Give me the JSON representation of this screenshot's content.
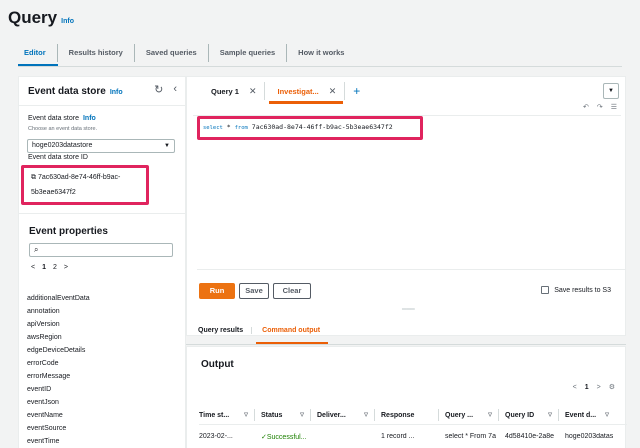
{
  "page": {
    "title": "Query",
    "info": "Info"
  },
  "tabs": [
    "Editor",
    "Results history",
    "Saved queries",
    "Sample queries",
    "How it works"
  ],
  "left_panel": {
    "title": "Event data store",
    "info": "Info",
    "refresh_icon": "refresh-icon",
    "collapse_icon": "chevron-left-icon",
    "store_label": "Event data store",
    "store_info": "Info",
    "store_hint": "Choose an event data store.",
    "store_value": "hoge0203datastore",
    "store_id_label": "Event data store ID",
    "store_id": "7ac630ad-8e74-46ff-b9ac-5b3eae6347f2",
    "event_props_title": "Event properties",
    "search_placeholder": "",
    "pager": {
      "prev": "<",
      "pages": [
        "1",
        "2"
      ],
      "next": ">"
    },
    "properties": [
      "additionalEventData",
      "annotation",
      "apiVersion",
      "awsRegion",
      "edgeDeviceDetails",
      "errorCode",
      "errorMessage",
      "eventID",
      "eventJson",
      "eventName",
      "eventSource",
      "eventTime"
    ]
  },
  "editor": {
    "tabs": [
      {
        "label": "Query 1",
        "active": false
      },
      {
        "label": "Investigat...",
        "active": true
      }
    ],
    "add_icon": "plus-icon",
    "query_kw1": "select",
    "query_star": " * ",
    "query_kw2": "from",
    "query_id": " 7ac630ad-8e74-46ff-b9ac-5b3eae6347f2",
    "run_label": "Run",
    "save_label": "Save",
    "clear_label": "Clear",
    "save_results_label": "Save results to S3"
  },
  "results": {
    "tabs": [
      "Query results",
      "Command output"
    ],
    "output_title": "Output",
    "pager": {
      "prev": "<",
      "current": "1",
      "next": ">"
    },
    "columns": [
      "Time st...",
      "Status",
      "Deliver...",
      "Response",
      "Query ...",
      "Query ID",
      "Event d..."
    ],
    "rows": [
      [
        "2023-02-...",
        "Successful...",
        "",
        "1 record ...",
        "select * From 7a",
        "4d58410e-2a8e",
        "hoge0203datas"
      ]
    ]
  },
  "colors": {
    "accent": "#0073bb",
    "run": "#ec7211",
    "highlight": "#e0245e",
    "success": "#1d8102"
  }
}
